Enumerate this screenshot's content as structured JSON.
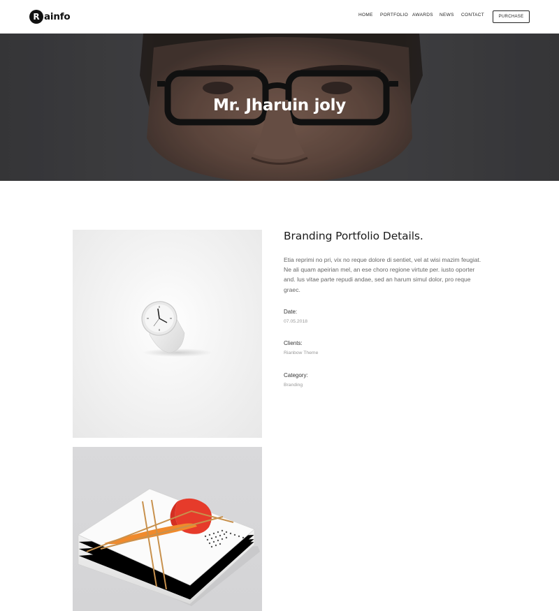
{
  "header": {
    "logo_mark": "R",
    "logo_text": "ainfo",
    "nav": [
      {
        "label": "HOME"
      },
      {
        "label": "PORTFOLIO"
      },
      {
        "label": "AWARDS"
      },
      {
        "label": "NEWS"
      },
      {
        "label": "CONTACT"
      }
    ],
    "purchase_label": "PURCHASE"
  },
  "hero": {
    "title": "Mr. Jharuin joly"
  },
  "details": {
    "title": "Branding Portfolio Details.",
    "description": "Etia reprimi no pri, vix no reque dolore di sentiet, vel at wisi mazim feugiat. Ne ali quam apeirian mel, an ese choro regione virtute per. iusto oporter and. lus vitae parte repudi andae, sed an harum simul dolor, pro reque graec.",
    "meta": [
      {
        "label": "Date:",
        "value": "07.05.2018"
      },
      {
        "label": "Clients:",
        "value": "Rianbow Theme"
      },
      {
        "label": "Category:",
        "value": "Branding"
      }
    ]
  },
  "colors": {
    "hero_overlay": "#4a4a4d",
    "text_dark": "#1b1b1b",
    "text_muted": "#999999"
  }
}
